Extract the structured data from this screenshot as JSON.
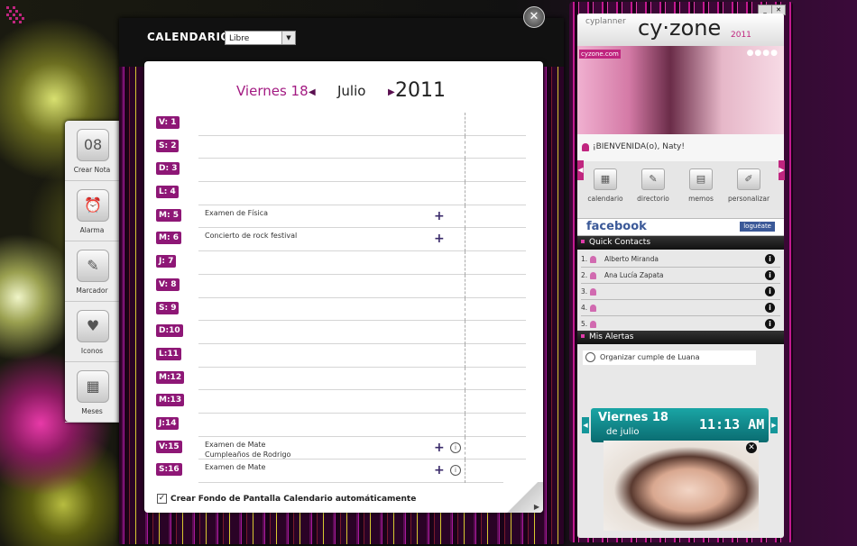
{
  "calendar": {
    "title": "CALENDARIO",
    "mode_select": "Libre",
    "close_symbol": "✕",
    "day_label": "Viernes 18",
    "month": "Julio",
    "year": "2011",
    "rows": [
      {
        "badge": "V: 1",
        "events": [],
        "plus": false,
        "info": false
      },
      {
        "badge": "S: 2",
        "events": [],
        "plus": false,
        "info": false
      },
      {
        "badge": "D: 3",
        "events": [],
        "plus": false,
        "info": false
      },
      {
        "badge": "L: 4",
        "events": [],
        "plus": false,
        "info": false
      },
      {
        "badge": "M: 5",
        "events": [
          "Examen de Física"
        ],
        "plus": true,
        "info": false
      },
      {
        "badge": "M: 6",
        "events": [
          "Concierto de rock festival"
        ],
        "plus": true,
        "info": false
      },
      {
        "badge": "J: 7",
        "events": [],
        "plus": false,
        "info": false
      },
      {
        "badge": "V: 8",
        "events": [],
        "plus": false,
        "info": false
      },
      {
        "badge": "S: 9",
        "events": [],
        "plus": false,
        "info": false
      },
      {
        "badge": "D:10",
        "events": [],
        "plus": false,
        "info": false
      },
      {
        "badge": "L:11",
        "events": [],
        "plus": false,
        "info": false
      },
      {
        "badge": "M:12",
        "events": [],
        "plus": false,
        "info": false
      },
      {
        "badge": "M:13",
        "events": [],
        "plus": false,
        "info": false
      },
      {
        "badge": "J:14",
        "events": [],
        "plus": false,
        "info": false
      },
      {
        "badge": "V:15",
        "events": [
          "Examen de Mate",
          "Cumpleaños de Rodrigo"
        ],
        "plus": true,
        "info": true
      },
      {
        "badge": "S:16",
        "events": [
          "Examen de Mate"
        ],
        "plus": true,
        "info": true
      }
    ],
    "checkbox_label": "Crear Fondo de Pantalla Calendario automáticamente",
    "checkbox_checked": true
  },
  "tools": [
    {
      "label": "Crear Nota",
      "icon": "calendar-note-icon",
      "glyph": "08"
    },
    {
      "label": "Alarma",
      "icon": "alarm-clock-icon",
      "glyph": "⏰"
    },
    {
      "label": "Marcador",
      "icon": "marker-icon",
      "glyph": "✎"
    },
    {
      "label": "Iconos",
      "icon": "heart-bubble-icon",
      "glyph": "♥"
    },
    {
      "label": "Meses",
      "icon": "month-grid-icon",
      "glyph": "▦"
    }
  ],
  "cyzone": {
    "subtitle": "cyplanner",
    "logo": "cy·zone",
    "year": "2011",
    "brand_tag": "cyzone.com",
    "welcome": "¡BIENVENIDA(o), Naty!",
    "nav": [
      {
        "label": "calendario",
        "icon": "calendar-icon",
        "glyph": "▦"
      },
      {
        "label": "directorio",
        "icon": "directory-icon",
        "glyph": "✎"
      },
      {
        "label": "memos",
        "icon": "memo-icon",
        "glyph": "▤"
      },
      {
        "label": "personalizar",
        "icon": "brush-icon",
        "glyph": "✐"
      }
    ],
    "facebook_label": "facebook",
    "facebook_button": "loguéate",
    "quick_contacts_title": "Quick Contacts",
    "contacts": [
      {
        "num": "1.",
        "name": "Alberto Miranda"
      },
      {
        "num": "2.",
        "name": "Ana Lucía Zapata"
      },
      {
        "num": "3.",
        "name": ""
      },
      {
        "num": "4.",
        "name": ""
      },
      {
        "num": "5.",
        "name": ""
      }
    ],
    "alerts_title": "Mis Alertas",
    "alert_text": "Organizar cumple de Luana",
    "clock_day": "Viernes 18",
    "clock_month": "de julio",
    "clock_time": "11:13 AM"
  }
}
